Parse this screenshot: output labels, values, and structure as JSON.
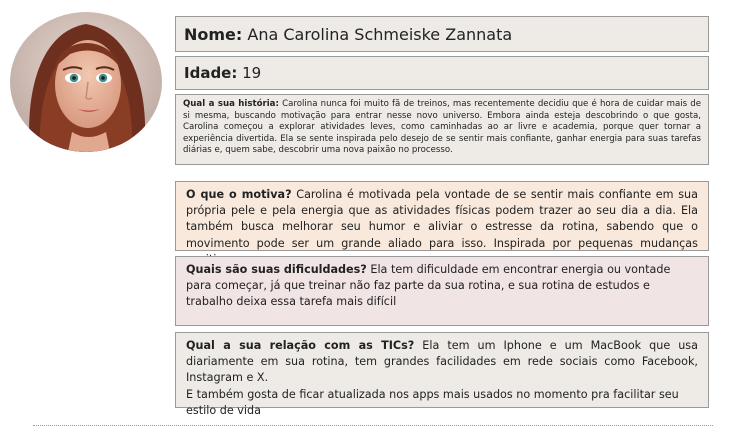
{
  "profile": {
    "name_label": "Nome:",
    "name_value": "Ana Carolina Schmeiske Zannata",
    "age_label": "Idade:",
    "age_value": "19",
    "story_label": "Qual a sua história:",
    "story_text": "Carolina nunca foi muito fã de treinos, mas recentemente decidiu que é hora de cuidar mais de si mesma, buscando motivação para entrar nesse novo universo. Embora ainda esteja descobrindo o que gosta, Carolina começou a explorar atividades leves, como caminhadas ao ar livre e academia, porque quer tornar a experiência divertida. Ela se sente inspirada pelo desejo de se sentir mais confiante, ganhar energia para suas tarefas diárias e, quem sabe, descobrir uma nova paixão no processo."
  },
  "motivation": {
    "label": "O que o motiva?",
    "text": "Carolina é motivada pela vontade de se sentir mais confiante em sua própria pele e pela energia que as atividades físicas podem trazer ao seu dia a dia. Ela também busca melhorar seu humor e aliviar o estresse da rotina, sabendo que o movimento pode ser um grande aliado para isso. Inspirada por pequenas mudanças positivas"
  },
  "difficulties": {
    "label": "Quais são suas dificuldades?",
    "text": "Ela tem dificuldade em encontrar energia ou vontade para começar, já que treinar não faz parte da sua rotina, e sua rotina de estudos e trabalho deixa essa tarefa mais difícil"
  },
  "tics": {
    "label": "Qual a sua relação com as TICs?",
    "text1": "Ela tem um Iphone e um MacBook que usa diariamente em sua rotina, tem grandes facilidades em rede sociais como Facebook, Instagram e X.",
    "text2": "E também gosta de ficar atualizada nos apps mais usados no momento pra facilitar seu estilo de vida"
  },
  "colors": {
    "gray_box": "#eeebe7",
    "peach_box": "#f8e9dc",
    "rose_box": "#f1e4e4"
  }
}
